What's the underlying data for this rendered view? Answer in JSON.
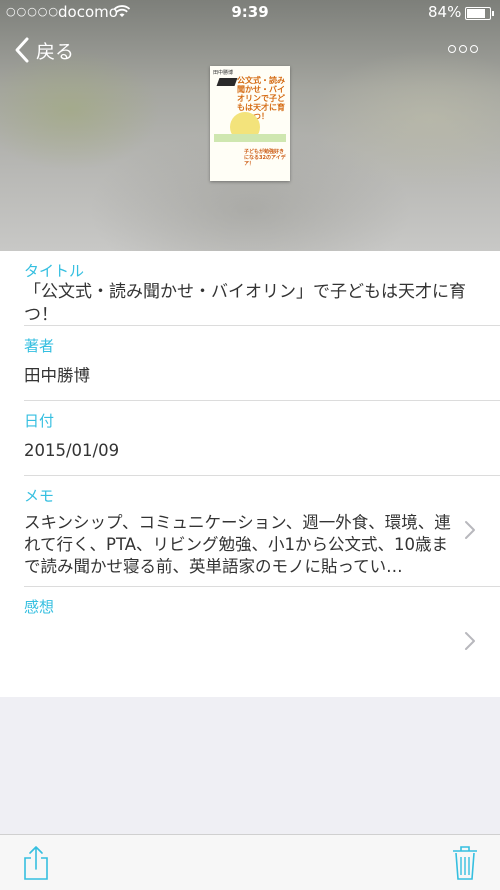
{
  "statusbar": {
    "signal": "○○○○○",
    "carrier": "docomo",
    "time": "9:39",
    "battery": "84%"
  },
  "nav": {
    "back_label": "戻る"
  },
  "cover": {
    "author": "田中勝博",
    "title": "公文式・読み聞かせ・バイオリンで子どもは天才に育つ！",
    "subtitle": "子どもが勉強好きになる32のアイデア！"
  },
  "fields": [
    {
      "label": "タイトル",
      "value": "「公文式・読み聞かせ・バイオリン」で子どもは天才に育つ！"
    },
    {
      "label": "著者",
      "value": "田中勝博"
    },
    {
      "label": "日付",
      "value": "2015/01/09"
    },
    {
      "label": "メモ",
      "value": "スキンシップ、コミュニケーション、週一外食、環境、連れて行く、PTA、リビング勉強、小1から公文式、10歳まで読み聞かせ寝る前、英単語家のモノに貼ってい…"
    },
    {
      "label": "感想",
      "value": ""
    }
  ],
  "colors": {
    "accent": "#35bfe0",
    "background": "#efeff4"
  },
  "icons": {
    "back": "chevron-left-icon",
    "more": "more-icon",
    "disclosure": "chevron-right-icon",
    "share": "share-icon",
    "trash": "trash-icon"
  }
}
